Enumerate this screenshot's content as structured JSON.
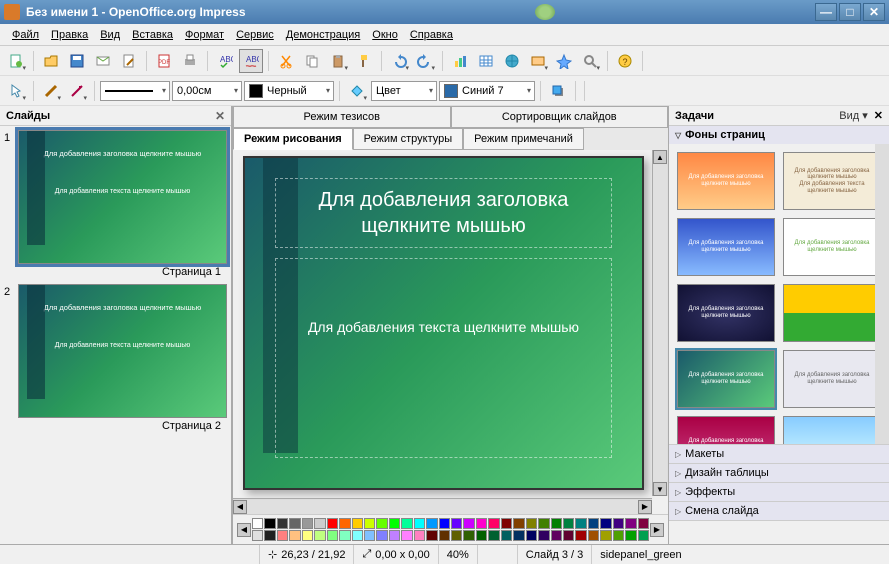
{
  "window": {
    "title": "Без имени 1 - OpenOffice.org Impress"
  },
  "menu": {
    "file": "Файл",
    "edit": "Правка",
    "view": "Вид",
    "insert": "Вставка",
    "format": "Формат",
    "tools": "Сервис",
    "slideshow": "Демонстрация",
    "window": "Окно",
    "help": "Справка"
  },
  "toolbar2": {
    "line_width": "0,00см",
    "color_black": "Черный",
    "fill_label": "Цвет",
    "fill_color": "Синий 7"
  },
  "slides_panel": {
    "title": "Слайды",
    "items": [
      {
        "num": "1",
        "label": "Страница 1",
        "title_ph": "Для добавления заголовка щелкните мышью",
        "body_ph": "Для добавления текста щелкните мышью"
      },
      {
        "num": "2",
        "label": "Страница 2",
        "title_ph": "Для добавления заголовка щелкните мышью",
        "body_ph": "Для добавления текста щелкните мышью"
      }
    ]
  },
  "view_tabs": {
    "outline_mode": "Режим тезисов",
    "slide_sorter": "Сортировщик слайдов",
    "drawing": "Режим рисования",
    "structure": "Режим структуры",
    "notes": "Режим примечаний"
  },
  "canvas": {
    "title_placeholder": "Для добавления заголовка щелкните мышью",
    "body_placeholder": "Для добавления текста щелкните мышью"
  },
  "tasks": {
    "title": "Задачи",
    "view_btn": "Вид",
    "sections": {
      "backgrounds": "Фоны страниц",
      "layouts": "Макеты",
      "table_design": "Дизайн таблицы",
      "effects": "Эффекты",
      "transition": "Смена слайда"
    }
  },
  "status": {
    "coords": "26,23 / 21,92",
    "size": "0,00 x 0,00",
    "zoom": "40%",
    "slide_counter": "Слайд 3 / 3",
    "template": "sidepanel_green"
  },
  "colors": {
    "row1": [
      "#ffffff",
      "#000000",
      "#333333",
      "#666666",
      "#999999",
      "#cccccc",
      "#ff0000",
      "#ff6600",
      "#ffcc00",
      "#ccff00",
      "#66ff00",
      "#00ff00",
      "#00ff99",
      "#00ffff",
      "#0099ff",
      "#0000ff",
      "#6600ff",
      "#cc00ff",
      "#ff00cc",
      "#ff0066",
      "#800000",
      "#804000",
      "#808000",
      "#408000",
      "#008000",
      "#008040",
      "#008080",
      "#004080",
      "#000080",
      "#400080",
      "#800080",
      "#800040"
    ],
    "row2": [
      "#e0e0e0",
      "#202020",
      "#ff8080",
      "#ffc080",
      "#ffff80",
      "#c0ff80",
      "#80ff80",
      "#80ffc0",
      "#80ffff",
      "#80c0ff",
      "#8080ff",
      "#c080ff",
      "#ff80ff",
      "#ff80c0",
      "#600000",
      "#603000",
      "#606000",
      "#306000",
      "#006000",
      "#006030",
      "#006060",
      "#003060",
      "#000060",
      "#300060",
      "#600060",
      "#600030",
      "#a00000",
      "#a05000",
      "#a0a000",
      "#50a000",
      "#00a000",
      "#00a050"
    ]
  }
}
